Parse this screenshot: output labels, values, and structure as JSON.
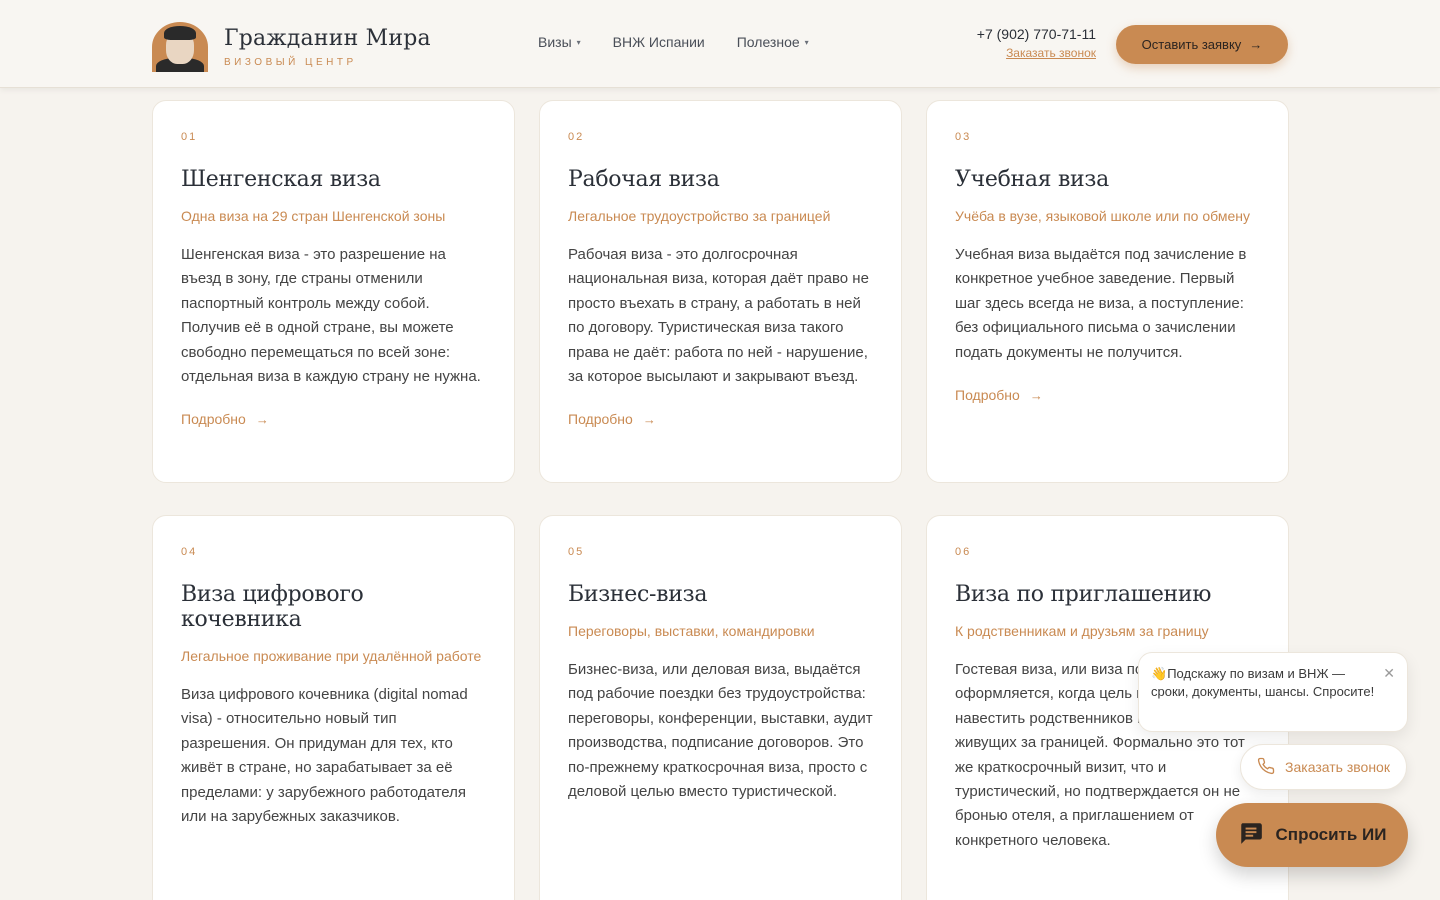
{
  "header": {
    "logo_title": "Гражданин Мира",
    "logo_subtitle": "ВИЗОВЫЙ ЦЕНТР",
    "nav": [
      {
        "label": "Визы",
        "dropdown": true
      },
      {
        "label": "ВНЖ Испании",
        "dropdown": false
      },
      {
        "label": "Полезное",
        "dropdown": true
      }
    ],
    "phone": "+7 (902) 770-71-11",
    "callback_link": "Заказать звонок",
    "cta_label": "Оставить заявку"
  },
  "cards": [
    {
      "num": "01",
      "title": "Шенгенская виза",
      "subtitle": "Одна виза на 29 стран Шенгенской зоны",
      "text": "Шенгенская виза - это разрешение на въезд в зону, где страны отменили паспортный контроль между собой. Получив её в одной стране, вы можете свободно перемещаться по всей зоне: отдельная виза в каждую страну не нужна.",
      "more": "Подробно"
    },
    {
      "num": "02",
      "title": "Рабочая виза",
      "subtitle": "Легальное трудоустройство за границей",
      "text": "Рабочая виза - это долгосрочная национальная виза, которая даёт право не просто въехать в страну, а работать в ней по договору. Туристическая виза такого права не даёт: работа по ней - нарушение, за которое высылают и закрывают въезд.",
      "more": "Подробно"
    },
    {
      "num": "03",
      "title": "Учебная виза",
      "subtitle": "Учёба в вузе, языковой школе или по обмену",
      "text": "Учебная виза выдаётся под зачисление в конкретное учебное заведение. Первый шаг здесь всегда не виза, а поступление: без официального письма о зачислении подать документы не получится.",
      "more": "Подробно"
    },
    {
      "num": "04",
      "title": "Виза цифрового кочевника",
      "subtitle": "Легальное проживание при удалённой работе",
      "text": "Виза цифрового кочевника (digital nomad visa) - относительно новый тип разрешения. Он придуман для тех, кто живёт в стране, но зарабатывает за её пределами: у зарубежного работодателя или на зарубежных заказчиков.",
      "more": ""
    },
    {
      "num": "05",
      "title": "Бизнес-виза",
      "subtitle": "Переговоры, выставки, командировки",
      "text": "Бизнес-виза, или деловая виза, выдаётся под рабочие поездки без трудоустройства: переговоры, конференции, выставки, аудит производства, подписание договоров. Это по-прежнему краткосрочная виза, просто с деловой целью вместо туристической.",
      "more": ""
    },
    {
      "num": "06",
      "title": "Виза по приглашению",
      "subtitle": "К родственникам и друзьям за границу",
      "text": "Гостевая виза, или виза по приглашению, оформляется, когда цель поездки - навестить родственников или друзей, живущих за границей. Формально это тот же краткосрочный визит, что и туристический, но подтверждается он не бронью отеля, а приглашением от конкретного человека.",
      "more": ""
    }
  ],
  "widgets": {
    "chat_emoji": "👋",
    "chat_text": "Подскажу по визам и ВНЖ — сроки, документы, шансы. Спросите!",
    "callback_label": "Заказать звонок",
    "ai_label": "Спросить ИИ"
  },
  "colors": {
    "accent": "#c98a52",
    "background": "#f6f3ee",
    "card": "#ffffff",
    "heading": "#2b3038"
  }
}
